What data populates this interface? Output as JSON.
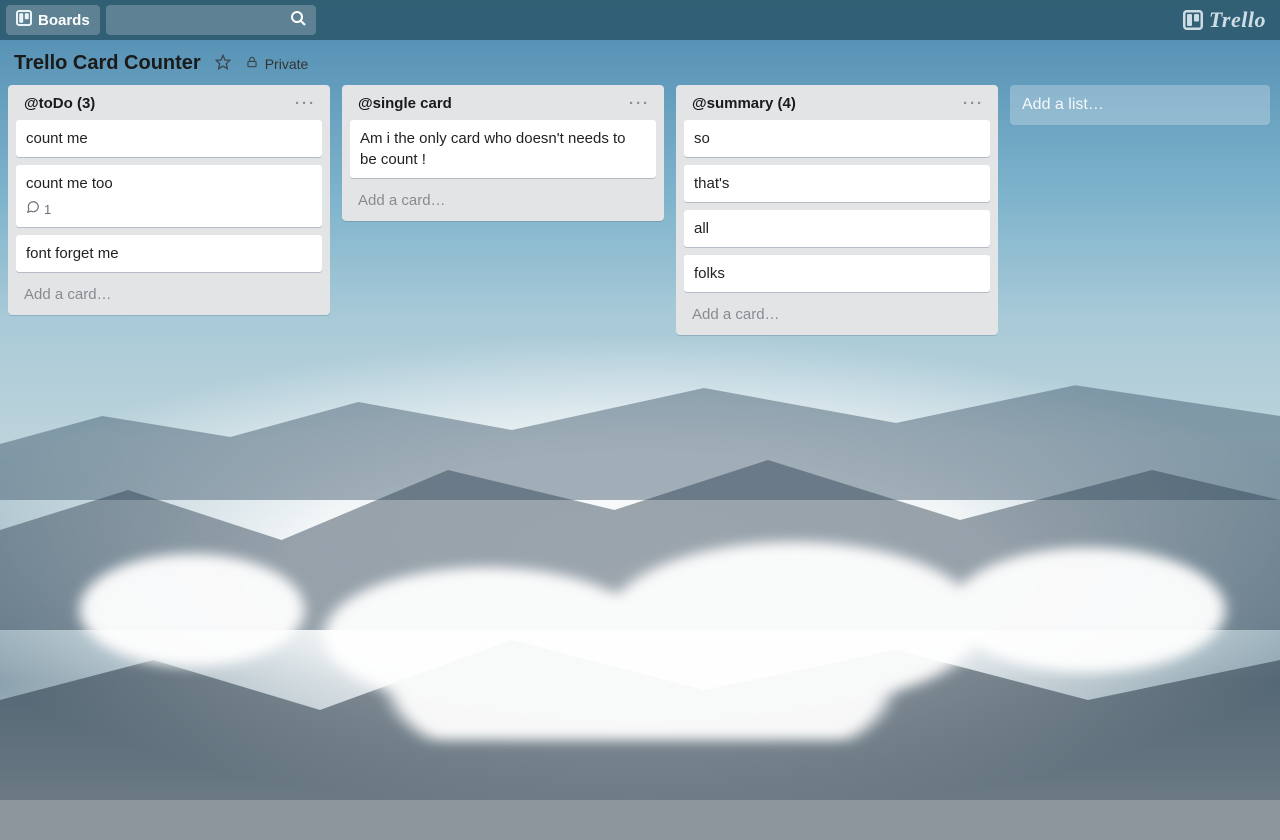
{
  "header": {
    "boards_label": "Boards",
    "brand": "Trello"
  },
  "board": {
    "title": "Trello Card Counter",
    "visibility": "Private"
  },
  "lists": [
    {
      "title": "@toDo (3)",
      "add_label": "Add a card…",
      "cards": [
        {
          "text": "count me"
        },
        {
          "text": "count me too",
          "comments": "1"
        },
        {
          "text": "font forget me"
        }
      ]
    },
    {
      "title": "@single card",
      "add_label": "Add a card…",
      "cards": [
        {
          "text": "Am i the only card who doesn't needs to be count !"
        }
      ]
    },
    {
      "title": "@summary (4)",
      "add_label": "Add a card…",
      "cards": [
        {
          "text": "so"
        },
        {
          "text": "that's"
        },
        {
          "text": "all"
        },
        {
          "text": "folks"
        }
      ]
    }
  ],
  "add_list_label": "Add a list…"
}
